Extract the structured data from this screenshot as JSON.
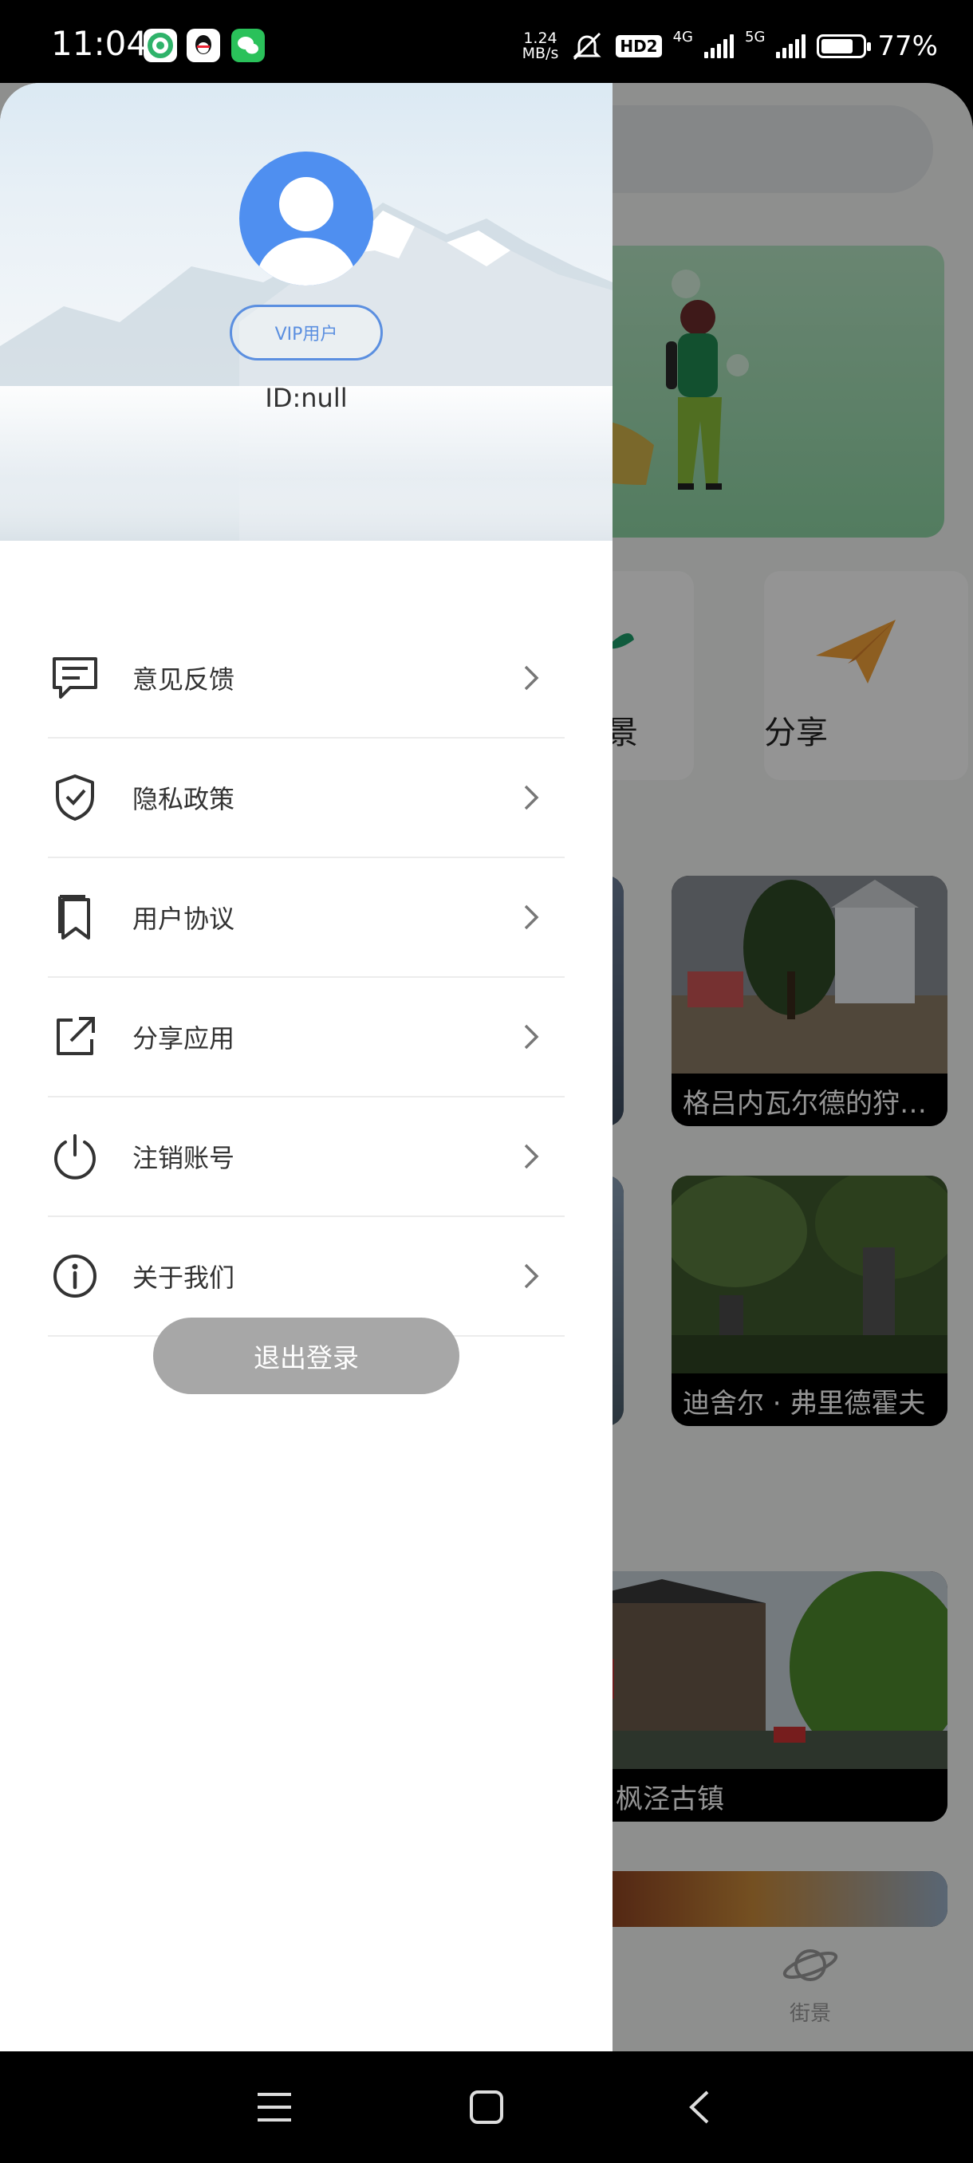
{
  "status_bar": {
    "time": "11:04",
    "network_speed_value": "1.24",
    "network_speed_unit": "MB/s",
    "hd_badge": "HD2",
    "net_4g": "4G",
    "net_5g": "5G",
    "battery_percent": "77%",
    "battery_level": 0.77,
    "app_icons": [
      "green-swirl-app-icon",
      "qq-icon",
      "wechat-icon"
    ]
  },
  "drawer": {
    "vip_label": "VIP用户",
    "user_id": "ID:null",
    "menu": [
      {
        "label": "意见反馈",
        "icon": "feedback-icon"
      },
      {
        "label": "隐私政策",
        "icon": "shield-check-icon"
      },
      {
        "label": "用户协议",
        "icon": "bookmark-icon"
      },
      {
        "label": "分享应用",
        "icon": "share-external-icon"
      },
      {
        "label": "注销账号",
        "icon": "power-icon"
      },
      {
        "label": "关于我们",
        "icon": "info-icon"
      }
    ],
    "logout_label": "退出登录"
  },
  "background_app": {
    "scene_label_partial": "景",
    "share_label": "分享",
    "photo_captions": [
      "格吕内瓦尔德的狩猎小屋",
      "迪舍尔 · 弗里德霍夫",
      "枫泾古镇"
    ],
    "tab_label": "街景"
  },
  "colors": {
    "accent_blue": "#4f8ff0",
    "logout_gray": "#a7a7a7",
    "banner_green": "#a8e0b8"
  }
}
